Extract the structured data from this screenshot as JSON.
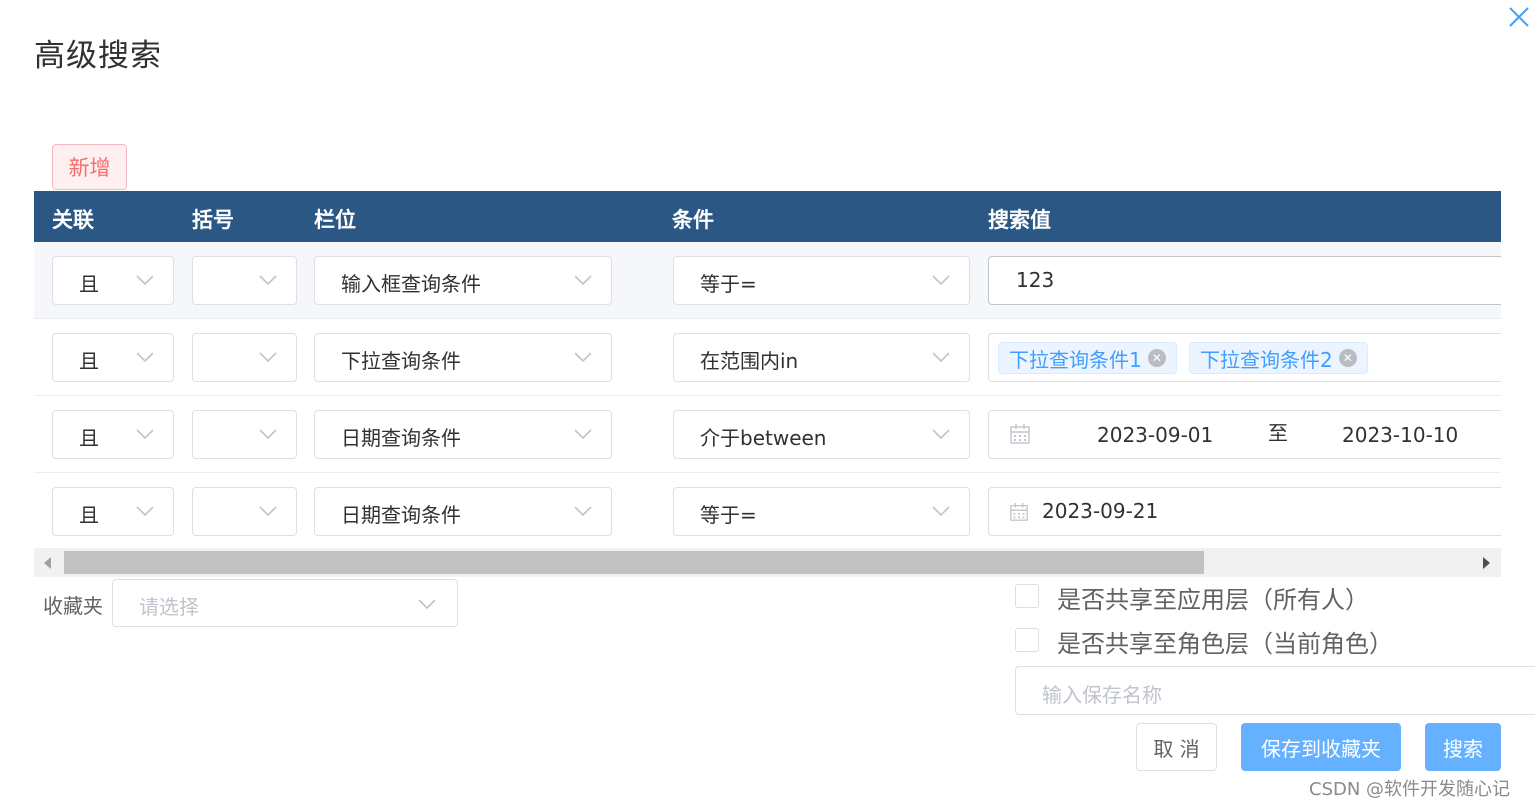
{
  "dialog": {
    "title": "高级搜索",
    "add_label": "新增"
  },
  "table": {
    "headers": [
      "关联",
      "括号",
      "栏位",
      "条件",
      "搜索值"
    ],
    "rows": [
      {
        "relation": "且",
        "bracket": "",
        "field": "输入框查询条件",
        "condition": "等于=",
        "value": "123"
      },
      {
        "relation": "且",
        "bracket": "",
        "field": "下拉查询条件",
        "condition": "在范围内in",
        "tags": [
          "下拉查询条件1",
          "下拉查询条件2"
        ]
      },
      {
        "relation": "且",
        "bracket": "",
        "field": "日期查询条件",
        "condition": "介于between",
        "date_start": "2023-09-01",
        "range_sep": "至",
        "date_end": "2023-10-10"
      },
      {
        "relation": "且",
        "bracket": "",
        "field": "日期查询条件",
        "condition": "等于=",
        "date": "2023-09-21"
      }
    ]
  },
  "footer": {
    "favorites_label": "收藏夹",
    "favorites_placeholder": "请选择",
    "share_app_label": "是否共享至应用层（所有人）",
    "share_role_label": "是否共享至角色层（当前角色）",
    "save_name_placeholder": "输入保存名称",
    "cancel_label": "取 消",
    "save_fav_label": "保存到收藏夹",
    "search_label": "搜索"
  },
  "watermark": "CSDN @软件开发随心记",
  "colors": {
    "header_bg": "#2a5784",
    "primary": "#409eff",
    "primary_light": "#66b1ff",
    "danger": "#f56c6c"
  }
}
